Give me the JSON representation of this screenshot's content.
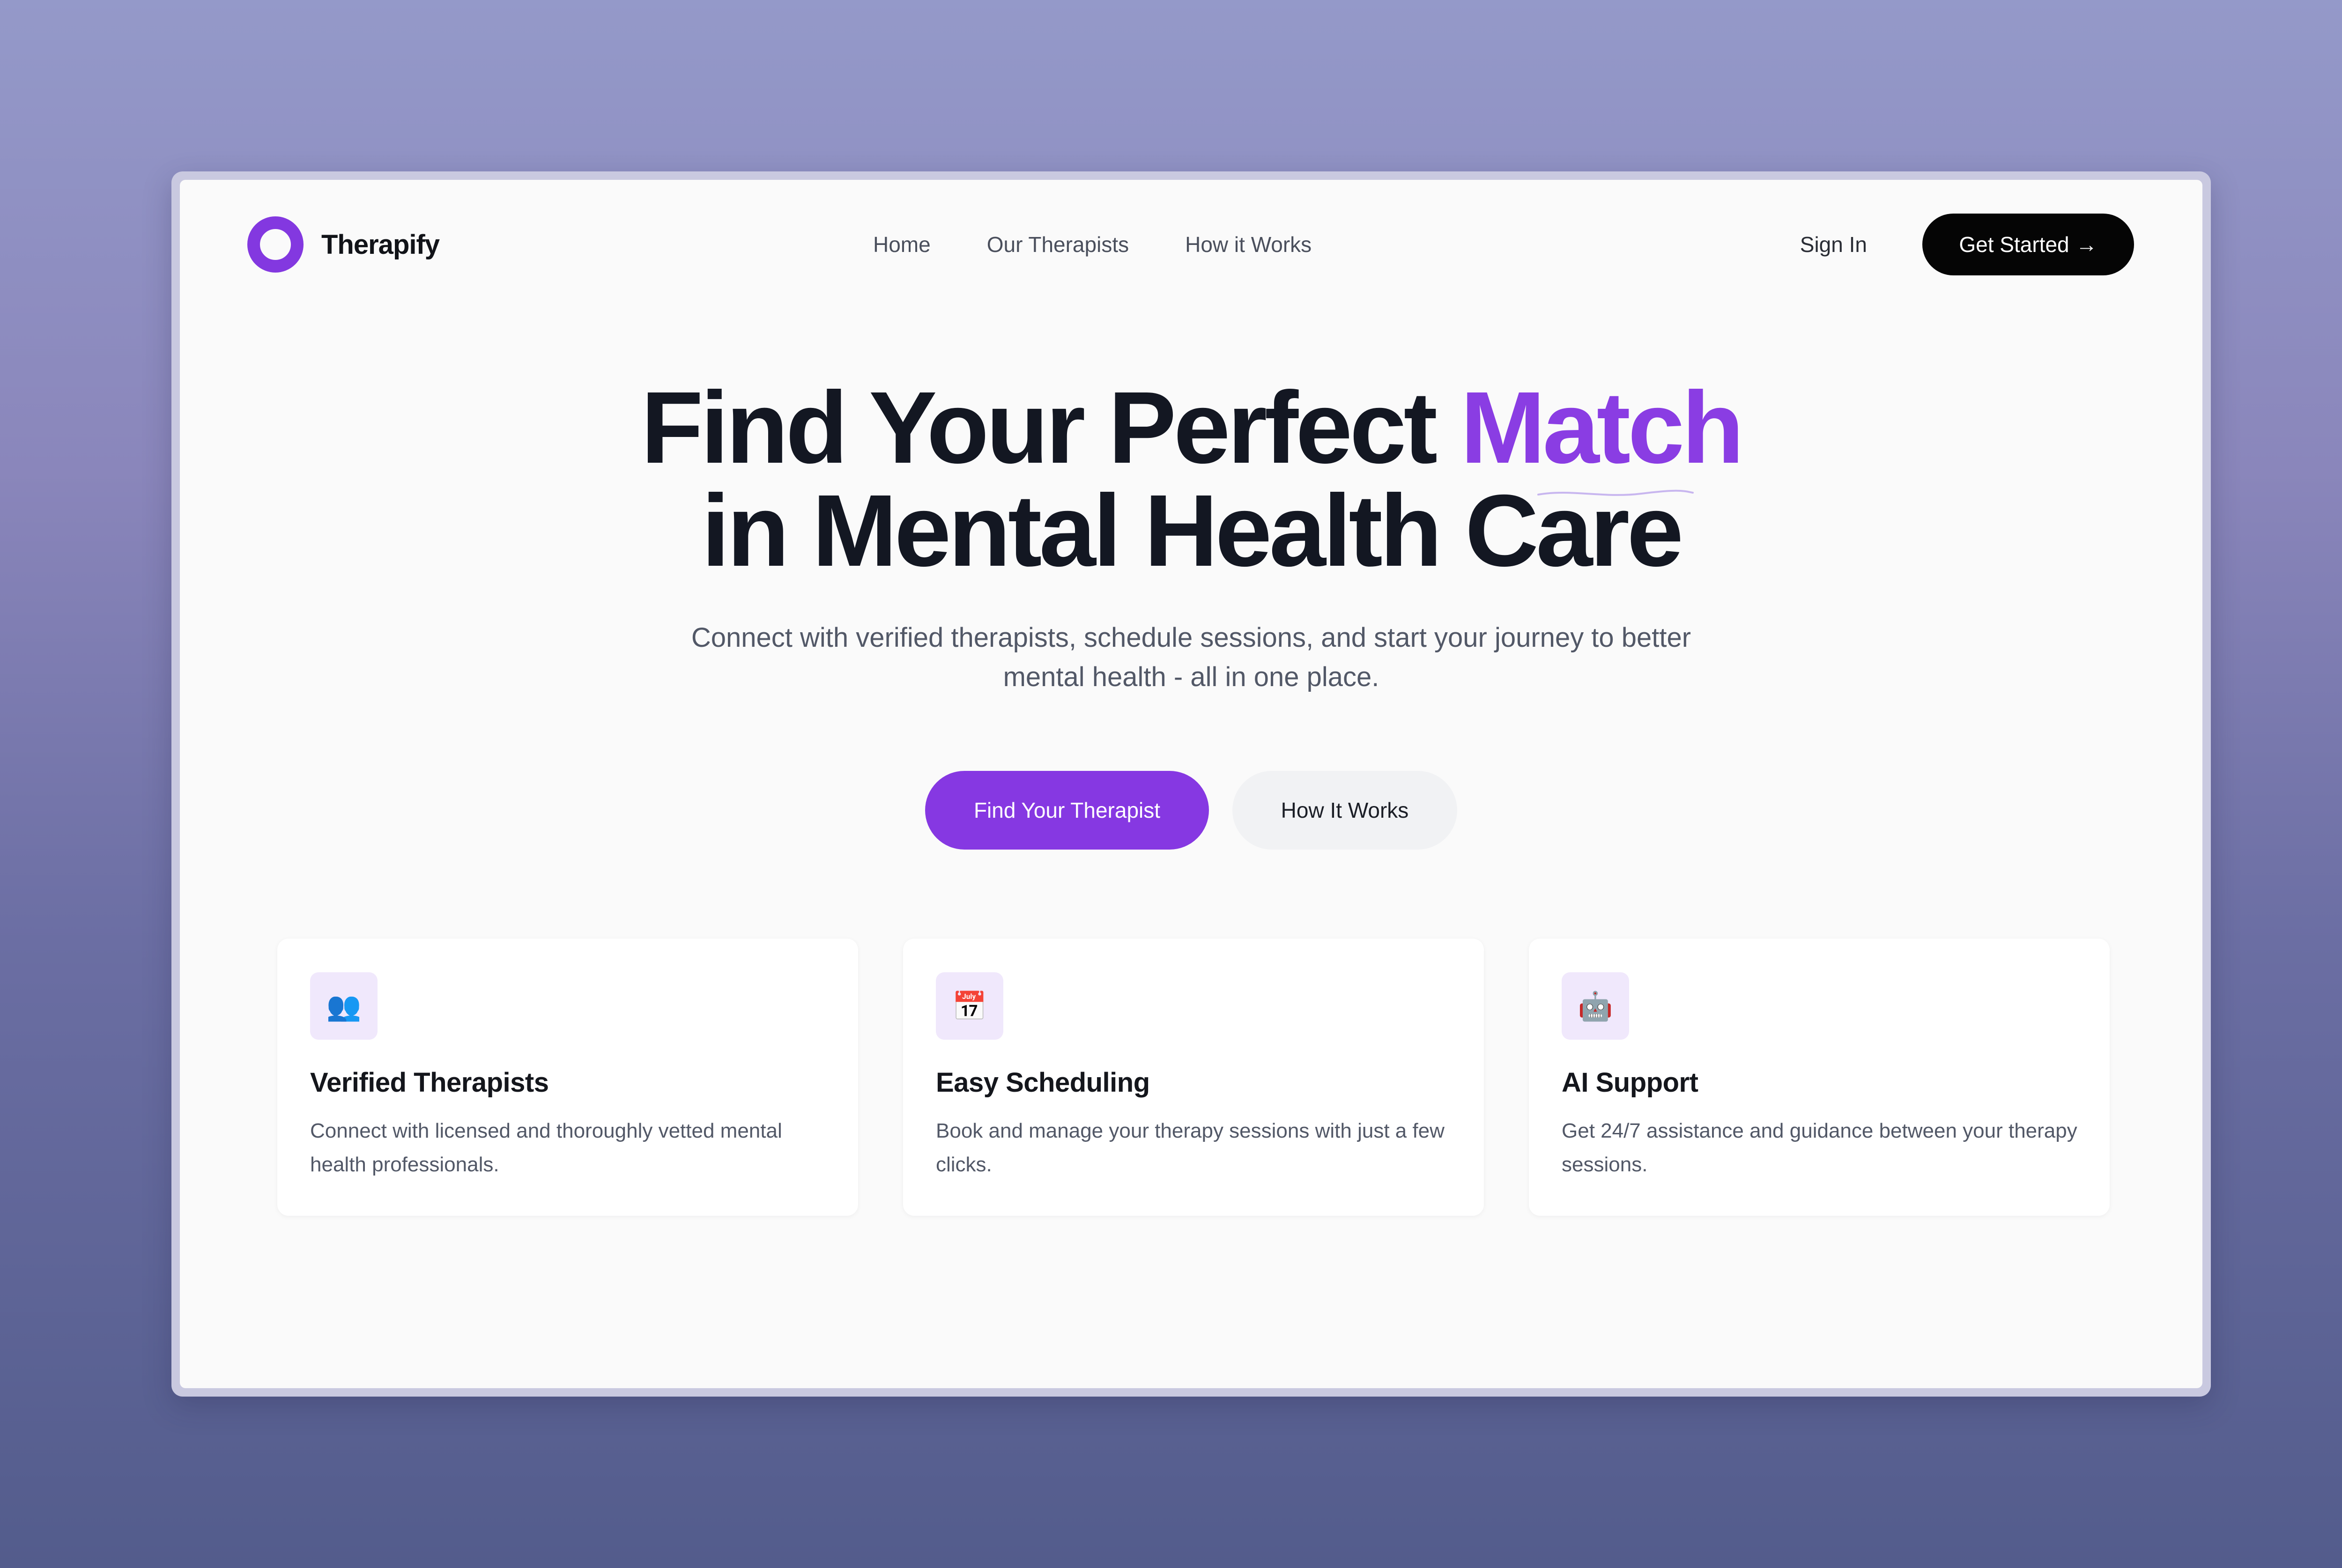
{
  "brand": {
    "name": "Therapify",
    "accent_color": "#8638e2"
  },
  "nav": {
    "links": [
      "Home",
      "Our Therapists",
      "How it Works"
    ],
    "sign_in": "Sign In",
    "get_started": "Get Started",
    "get_started_icon": "→"
  },
  "hero": {
    "title_part1": "Find Your Perfect ",
    "title_accent": "Match",
    "title_line2": "in Mental Health Care",
    "subtitle_line1": "Connect with verified therapists, schedule sessions, and start your journey to better",
    "subtitle_line2": "mental health - all in one place.",
    "primary_cta": "Find Your Therapist",
    "secondary_cta": "How It Works"
  },
  "features": [
    {
      "icon": "👥",
      "icon_name": "people-icon",
      "title": "Verified Therapists",
      "description": "Connect with licensed and thoroughly vetted mental health professionals."
    },
    {
      "icon": "📅",
      "icon_name": "calendar-icon",
      "title": "Easy Scheduling",
      "description": "Book and manage your therapy sessions with just a few clicks."
    },
    {
      "icon": "🤖",
      "icon_name": "robot-icon",
      "title": "AI Support",
      "description": "Get 24/7 assistance and guidance between your therapy sessions."
    }
  ]
}
